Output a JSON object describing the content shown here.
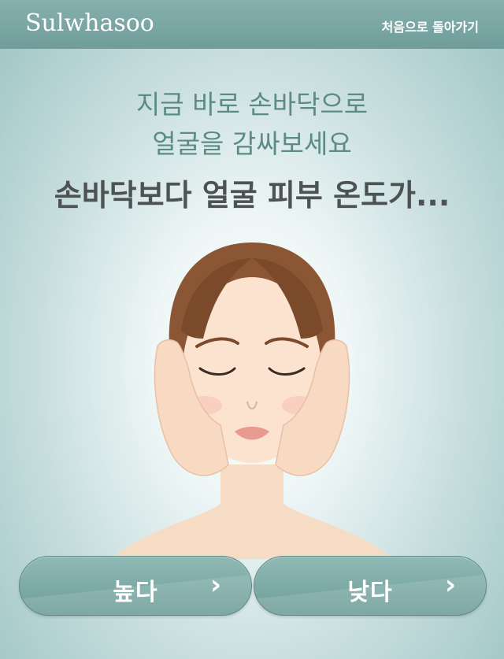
{
  "header": {
    "logo_text": "Sulwhasoo",
    "home_link": "처음으로 돌아가기"
  },
  "content": {
    "subtitle_line1": "지금 바로 손바닥으로",
    "subtitle_line2": "얼굴을 감싸보세요",
    "headline": "손바닥보다 얼굴 피부 온도가..."
  },
  "illustration": {
    "icon": "woman-face-hands-illustration"
  },
  "buttons": {
    "high_label": "높다",
    "low_label": "낮다",
    "arrow_icon": "chevron-right-icon"
  },
  "colors": {
    "accent": "#7aa6a2",
    "subtitle": "#5c8b84",
    "headline": "#4d5252"
  }
}
